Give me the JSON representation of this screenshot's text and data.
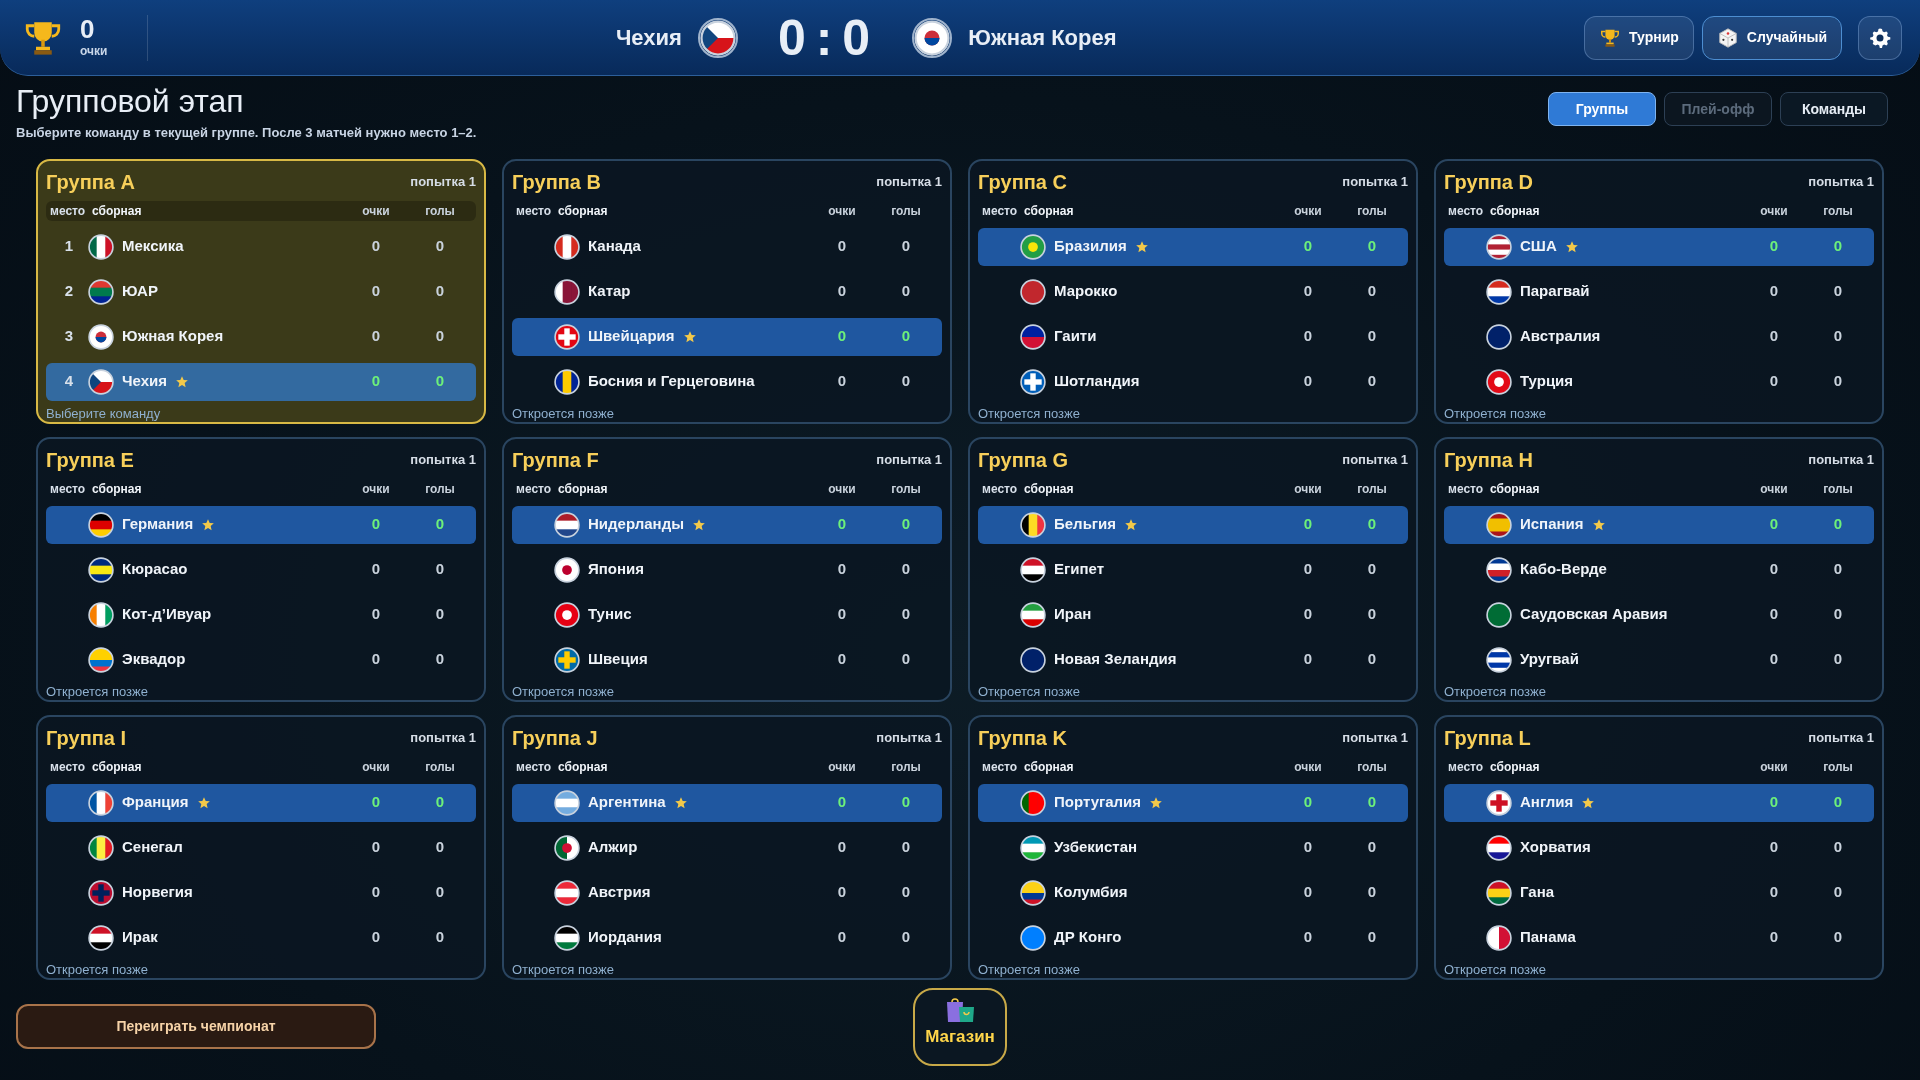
{
  "header": {
    "score": "0",
    "score_label": "очки",
    "home": {
      "name": "Чехия"
    },
    "home_goals": "0",
    "separator": ":",
    "away_goals": "0",
    "away": {
      "name": "Южная Корея"
    },
    "buttons": [
      {
        "label": "Турнир",
        "kind": "trophy"
      },
      {
        "label": "Случайный",
        "kind": "dice"
      }
    ]
  },
  "page": {
    "title": "Групповой этап",
    "subtitle": "Выберите команду в текущей группе. После 3 матчей нужно место 1–2."
  },
  "view_tabs": [
    {
      "label": "Группы",
      "selected": true,
      "disabled": false
    },
    {
      "label": "Плей-офф",
      "selected": false,
      "disabled": true
    },
    {
      "label": "Команды",
      "selected": false,
      "disabled": false
    }
  ],
  "groups": [
    {
      "name": "Группа A",
      "attempt": "попытка 1",
      "current": true,
      "columns": [
        "место",
        "сборная",
        "очки",
        "голы"
      ],
      "teams": [
        {
          "place": "1",
          "name": "Мексика",
          "favorite": false,
          "selected": false,
          "points": "0",
          "goals": "0"
        },
        {
          "place": "2",
          "name": "ЮАР",
          "favorite": false,
          "selected": false,
          "points": "0",
          "goals": "0"
        },
        {
          "place": "3",
          "name": "Южная Корея",
          "favorite": false,
          "selected": false,
          "points": "0",
          "goals": "0"
        },
        {
          "place": "4",
          "name": "Чехия",
          "favorite": true,
          "selected": true,
          "points": "0",
          "goals": "0"
        }
      ],
      "footer": "Выберите команду"
    },
    {
      "name": "Группа B",
      "attempt": "попытка 1",
      "current": false,
      "columns": [
        "место",
        "сборная",
        "очки",
        "голы"
      ],
      "teams": [
        {
          "name": "Канада",
          "favorite": false,
          "selected": false,
          "points": "0",
          "goals": "0"
        },
        {
          "name": "Катар",
          "favorite": false,
          "selected": false,
          "points": "0",
          "goals": "0"
        },
        {
          "name": "Швейцария",
          "favorite": true,
          "selected": true,
          "points": "0",
          "goals": "0"
        },
        {
          "name": "Босния и Герцеговина",
          "favorite": false,
          "selected": false,
          "points": "0",
          "goals": "0"
        }
      ],
      "footer": "Откроется позже"
    },
    {
      "name": "Группа C",
      "attempt": "попытка 1",
      "current": false,
      "columns": [
        "место",
        "сборная",
        "очки",
        "голы"
      ],
      "teams": [
        {
          "name": "Бразилия",
          "favorite": true,
          "selected": true,
          "points": "0",
          "goals": "0"
        },
        {
          "name": "Марокко",
          "favorite": false,
          "selected": false,
          "points": "0",
          "goals": "0"
        },
        {
          "name": "Гаити",
          "favorite": false,
          "selected": false,
          "points": "0",
          "goals": "0"
        },
        {
          "name": "Шотландия",
          "favorite": false,
          "selected": false,
          "points": "0",
          "goals": "0"
        }
      ],
      "footer": "Откроется позже"
    },
    {
      "name": "Группа D",
      "attempt": "попытка 1",
      "current": false,
      "columns": [
        "место",
        "сборная",
        "очки",
        "голы"
      ],
      "teams": [
        {
          "name": "США",
          "favorite": true,
          "selected": true,
          "points": "0",
          "goals": "0"
        },
        {
          "name": "Парагвай",
          "favorite": false,
          "selected": false,
          "points": "0",
          "goals": "0"
        },
        {
          "name": "Австралия",
          "favorite": false,
          "selected": false,
          "points": "0",
          "goals": "0"
        },
        {
          "name": "Турция",
          "favorite": false,
          "selected": false,
          "points": "0",
          "goals": "0"
        }
      ],
      "footer": "Откроется позже"
    },
    {
      "name": "Группа E",
      "attempt": "попытка 1",
      "current": false,
      "columns": [
        "место",
        "сборная",
        "очки",
        "голы"
      ],
      "teams": [
        {
          "name": "Германия",
          "favorite": true,
          "selected": true,
          "points": "0",
          "goals": "0"
        },
        {
          "name": "Кюрасао",
          "favorite": false,
          "selected": false,
          "points": "0",
          "goals": "0"
        },
        {
          "name": "Кот-д’Ивуар",
          "favorite": false,
          "selected": false,
          "points": "0",
          "goals": "0"
        },
        {
          "name": "Эквадор",
          "favorite": false,
          "selected": false,
          "points": "0",
          "goals": "0"
        }
      ],
      "footer": "Откроется позже"
    },
    {
      "name": "Группа F",
      "attempt": "попытка 1",
      "current": false,
      "columns": [
        "место",
        "сборная",
        "очки",
        "голы"
      ],
      "teams": [
        {
          "name": "Нидерланды",
          "favorite": true,
          "selected": true,
          "points": "0",
          "goals": "0"
        },
        {
          "name": "Япония",
          "favorite": false,
          "selected": false,
          "points": "0",
          "goals": "0"
        },
        {
          "name": "Тунис",
          "favorite": false,
          "selected": false,
          "points": "0",
          "goals": "0"
        },
        {
          "name": "Швеция",
          "favorite": false,
          "selected": false,
          "points": "0",
          "goals": "0"
        }
      ],
      "footer": "Откроется позже"
    },
    {
      "name": "Группа G",
      "attempt": "попытка 1",
      "current": false,
      "columns": [
        "место",
        "сборная",
        "очки",
        "голы"
      ],
      "teams": [
        {
          "name": "Бельгия",
          "favorite": true,
          "selected": true,
          "points": "0",
          "goals": "0"
        },
        {
          "name": "Египет",
          "favorite": false,
          "selected": false,
          "points": "0",
          "goals": "0"
        },
        {
          "name": "Иран",
          "favorite": false,
          "selected": false,
          "points": "0",
          "goals": "0"
        },
        {
          "name": "Новая Зеландия",
          "favorite": false,
          "selected": false,
          "points": "0",
          "goals": "0"
        }
      ],
      "footer": "Откроется позже"
    },
    {
      "name": "Группа H",
      "attempt": "попытка 1",
      "current": false,
      "columns": [
        "место",
        "сборная",
        "очки",
        "голы"
      ],
      "teams": [
        {
          "name": "Испания",
          "favorite": true,
          "selected": true,
          "points": "0",
          "goals": "0"
        },
        {
          "name": "Кабо-Верде",
          "favorite": false,
          "selected": false,
          "points": "0",
          "goals": "0"
        },
        {
          "name": "Саудовская Аравия",
          "favorite": false,
          "selected": false,
          "points": "0",
          "goals": "0"
        },
        {
          "name": "Уругвай",
          "favorite": false,
          "selected": false,
          "points": "0",
          "goals": "0"
        }
      ],
      "footer": "Откроется позже"
    },
    {
      "name": "Группа I",
      "attempt": "попытка 1",
      "current": false,
      "columns": [
        "место",
        "сборная",
        "очки",
        "голы"
      ],
      "teams": [
        {
          "name": "Франция",
          "favorite": true,
          "selected": true,
          "points": "0",
          "goals": "0"
        },
        {
          "name": "Сенегал",
          "favorite": false,
          "selected": false,
          "points": "0",
          "goals": "0"
        },
        {
          "name": "Норвегия",
          "favorite": false,
          "selected": false,
          "points": "0",
          "goals": "0"
        },
        {
          "name": "Ирак",
          "favorite": false,
          "selected": false,
          "points": "0",
          "goals": "0"
        }
      ],
      "footer": "Откроется позже"
    },
    {
      "name": "Группа J",
      "attempt": "попытка 1",
      "current": false,
      "columns": [
        "место",
        "сборная",
        "очки",
        "голы"
      ],
      "teams": [
        {
          "name": "Аргентина",
          "favorite": true,
          "selected": true,
          "points": "0",
          "goals": "0"
        },
        {
          "name": "Алжир",
          "favorite": false,
          "selected": false,
          "points": "0",
          "goals": "0"
        },
        {
          "name": "Австрия",
          "favorite": false,
          "selected": false,
          "points": "0",
          "goals": "0"
        },
        {
          "name": "Иордания",
          "favorite": false,
          "selected": false,
          "points": "0",
          "goals": "0"
        }
      ],
      "footer": "Откроется позже"
    },
    {
      "name": "Группа K",
      "attempt": "попытка 1",
      "current": false,
      "columns": [
        "место",
        "сборная",
        "очки",
        "голы"
      ],
      "teams": [
        {
          "name": "Португалия",
          "favorite": true,
          "selected": true,
          "points": "0",
          "goals": "0"
        },
        {
          "name": "Узбекистан",
          "favorite": false,
          "selected": false,
          "points": "0",
          "goals": "0"
        },
        {
          "name": "Колумбия",
          "favorite": false,
          "selected": false,
          "points": "0",
          "goals": "0"
        },
        {
          "name": "ДР Конго",
          "favorite": false,
          "selected": false,
          "points": "0",
          "goals": "0"
        }
      ],
      "footer": "Откроется позже"
    },
    {
      "name": "Группа L",
      "attempt": "попытка 1",
      "current": false,
      "columns": [
        "место",
        "сборная",
        "очки",
        "голы"
      ],
      "teams": [
        {
          "name": "Англия",
          "favorite": true,
          "selected": true,
          "points": "0",
          "goals": "0"
        },
        {
          "name": "Хорватия",
          "favorite": false,
          "selected": false,
          "points": "0",
          "goals": "0"
        },
        {
          "name": "Гана",
          "favorite": false,
          "selected": false,
          "points": "0",
          "goals": "0"
        },
        {
          "name": "Панама",
          "favorite": false,
          "selected": false,
          "points": "0",
          "goals": "0"
        }
      ],
      "footer": "Откроется позже"
    }
  ],
  "replay_button": {
    "label": "Переиграть чемпионат"
  },
  "shop_button": {
    "label": "Магазин"
  }
}
